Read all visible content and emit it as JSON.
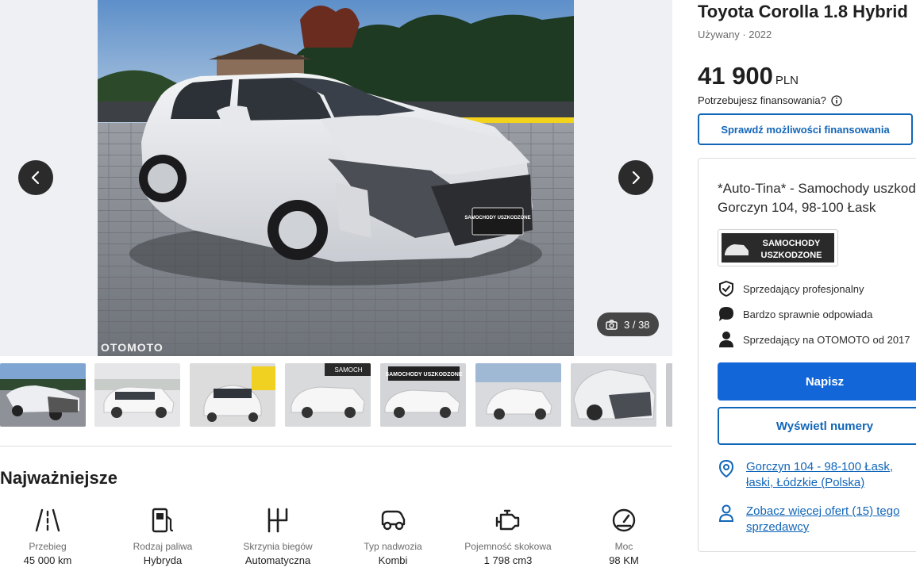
{
  "gallery": {
    "counter": "3 / 38",
    "watermark": "OTOMOTO",
    "plate_text": "SAMOCHODY USZKODZONE",
    "thumb_banner": "SAMOCHODY USZKODZONE",
    "thumb_sign": "SAMOCH"
  },
  "highlights": {
    "title": "Najważniejsze",
    "items": [
      {
        "label": "Przebieg",
        "value": "45 000 km",
        "icon": "road-icon"
      },
      {
        "label": "Rodzaj paliwa",
        "value": "Hybryda",
        "icon": "fuel-pump-icon"
      },
      {
        "label": "Skrzynia biegów",
        "value": "Automatyczna",
        "icon": "gearbox-icon"
      },
      {
        "label": "Typ nadwozia",
        "value": "Kombi",
        "icon": "car-body-icon"
      },
      {
        "label": "Pojemność skokowa",
        "value": "1 798 cm3",
        "icon": "engine-icon"
      },
      {
        "label": "Moc",
        "value": "98 KM",
        "icon": "speedometer-icon"
      }
    ]
  },
  "listing": {
    "title": "Toyota Corolla 1.8 Hybrid",
    "subtitle": "Używany · 2022",
    "price": "41 900",
    "currency": "PLN",
    "finance_question": "Potrzebujesz finansowania?",
    "finance_button": "Sprawdź możliwości finansowania"
  },
  "seller": {
    "name": "*Auto-Tina* - Samochody uszkodzone",
    "address": "Gorczyn 104, 98-100 Łask",
    "logo_text_1": "SAMOCHODY",
    "logo_text_2": "USZKODZONE",
    "badges": [
      "Sprzedający profesjonalny",
      "Bardzo sprawnie odpowiada",
      "Sprzedający na OTOMOTO od 2017"
    ],
    "write_button": "Napisz",
    "phone_button": "Wyświetl numery",
    "location_link": "Gorczyn 104 - 98-100 Łask, łaski, Łódzkie (Polska)",
    "more_offers_link": "Zobacz więcej ofert (15) tego sprzedawcy"
  },
  "colors": {
    "accent": "#1266b8",
    "primary_button": "#1266d8"
  }
}
